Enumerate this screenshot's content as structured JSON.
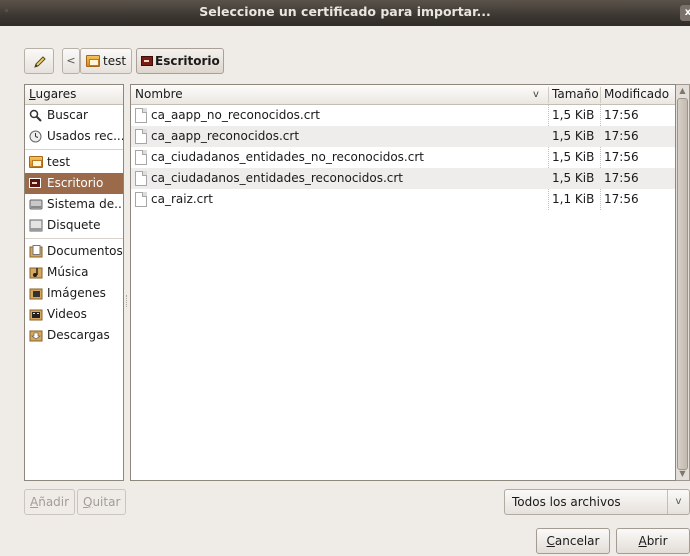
{
  "window": {
    "title": "Seleccione un certificado para importar...",
    "close_glyph": "x",
    "menu_glyph": "◦"
  },
  "pathbar": {
    "back_glyph": "<",
    "crumbs": [
      {
        "label": "test",
        "icon": "folder-home-icon"
      },
      {
        "label": "Escritorio",
        "icon": "desktop-icon"
      }
    ]
  },
  "sidebar": {
    "header": "Lugares",
    "header_mnemonic": "L",
    "header_rest": "ugares",
    "items": [
      {
        "label": "Buscar",
        "icon": "search-icon"
      },
      {
        "label": "Usados rec...",
        "icon": "recent-icon"
      },
      {
        "label": "test",
        "icon": "folder-home-icon"
      },
      {
        "label": "Escritorio",
        "icon": "desktop-icon",
        "selected": true
      },
      {
        "label": "Sistema de...",
        "icon": "drive-icon"
      },
      {
        "label": "Disquete",
        "icon": "floppy-icon"
      },
      {
        "label": "Documentos",
        "icon": "documents-icon"
      },
      {
        "label": "Música",
        "icon": "music-icon"
      },
      {
        "label": "Imágenes",
        "icon": "pictures-icon"
      },
      {
        "label": "Videos",
        "icon": "videos-icon"
      },
      {
        "label": "Descargas",
        "icon": "downloads-icon"
      }
    ]
  },
  "filelist": {
    "columns": {
      "name": "Nombre",
      "size": "Tamaño",
      "modified": "Modificado"
    },
    "sort_glyph": "v",
    "rows": [
      {
        "name": "ca_aapp_no_reconocidos.crt",
        "size": "1,5 KiB",
        "modified": "17:56"
      },
      {
        "name": "ca_aapp_reconocidos.crt",
        "size": "1,5 KiB",
        "modified": "17:56"
      },
      {
        "name": "ca_ciudadanos_entidades_no_reconocidos.crt",
        "size": "1,5 KiB",
        "modified": "17:56"
      },
      {
        "name": "ca_ciudadanos_entidades_reconocidos.crt",
        "size": "1,5 KiB",
        "modified": "17:56"
      },
      {
        "name": "ca_raiz.crt",
        "size": "1,1 KiB",
        "modified": "17:56"
      }
    ]
  },
  "bottom": {
    "add_mnemonic": "A",
    "add_rest": "ñadir",
    "remove_mnemonic": "Q",
    "remove_rest": "uitar",
    "filter_value": "Todos los archivos",
    "filter_glyph": "v",
    "cancel_mnemonic": "C",
    "cancel_rest": "ancelar",
    "open_mnemonic": "A",
    "open_rest": "brir"
  },
  "colors": {
    "selection": "#9b6a4a",
    "titlebar": "#3c3731",
    "window_bg": "#efebe7"
  }
}
